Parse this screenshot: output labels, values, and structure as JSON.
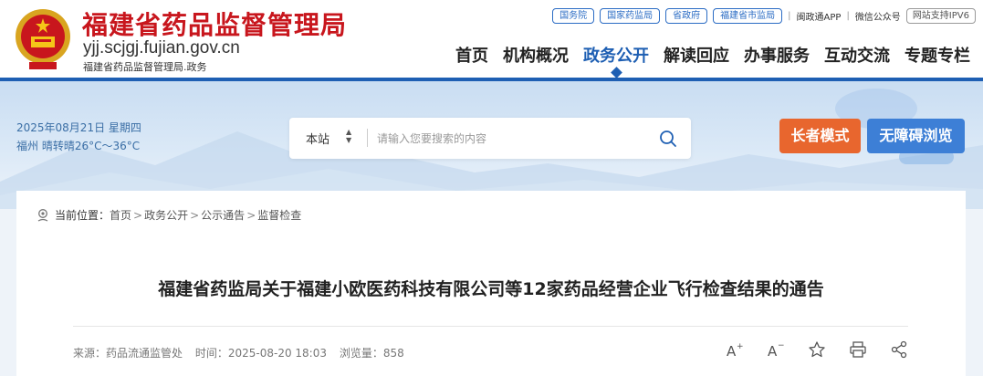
{
  "header": {
    "title": "福建省药品监督管理局",
    "domain": "yjj.scjgj.fujian.gov.cn",
    "subtitle": "福建省药品监督管理局.政务",
    "top_links": [
      "国务院",
      "国家药监局",
      "省政府",
      "福建省市监局"
    ],
    "app_link": "闽政通APP",
    "wechat_link": "微信公众号",
    "separator": "|",
    "ipv6": "网站支持IPV6",
    "nav": [
      "首页",
      "机构概况",
      "政务公开",
      "解读回应",
      "办事服务",
      "互动交流",
      "专题专栏"
    ],
    "active_nav": "政务公开"
  },
  "banner": {
    "date": "2025年08月21日 星期四",
    "weather": "福州 晴转晴26°C～36°C",
    "search": {
      "scope": "本站",
      "placeholder": "请输入您要搜索的内容"
    },
    "elder_mode": "长者模式",
    "accessible": "无障碍浏览"
  },
  "article": {
    "location_label": "当前位置：",
    "breadcrumb": [
      "首页",
      "政务公开",
      "公示通告",
      "监督检查"
    ],
    "breadcrumb_sep": ">",
    "title": "福建省药监局关于福建小欧医药科技有限公司等12家药品经营企业飞行检查结果的通告",
    "source": "来源：药品流通监管处",
    "time": "时间：2025-08-20 18:03",
    "views": "浏览量：858",
    "tools": [
      "font-increase-icon",
      "font-decrease-icon",
      "star-icon",
      "print-icon",
      "share-icon"
    ]
  },
  "colors": {
    "brand_red": "#c8161d",
    "brand_blue": "#1e5fb3",
    "elder_orange": "#e8662e",
    "access_blue": "#3d7fd6"
  }
}
